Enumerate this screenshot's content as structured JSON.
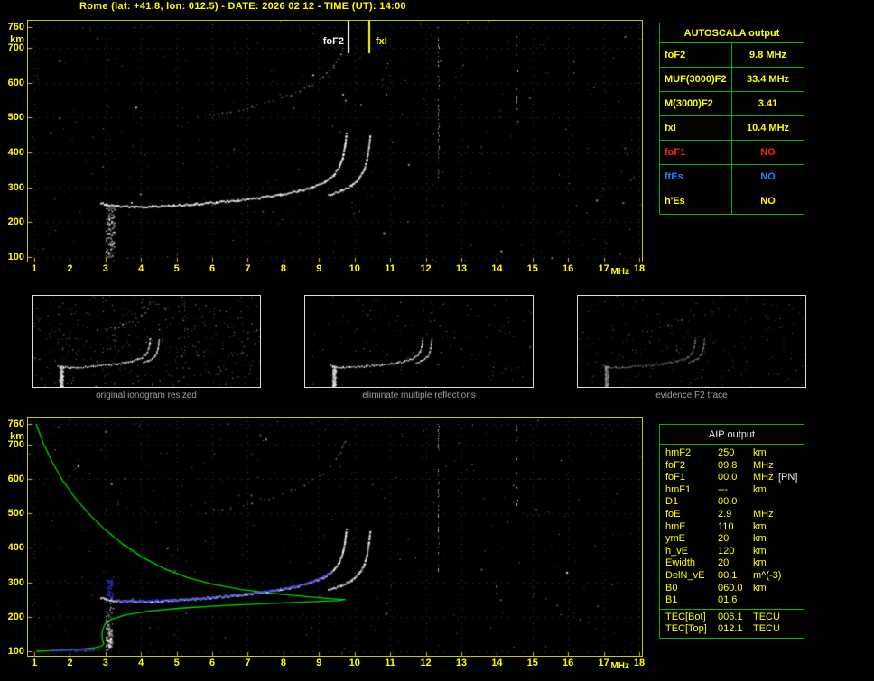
{
  "title": "Rome (lat: +41.8, lon: 012.5) - DATE: 2026 02 12 - TIME (UT): 14:00",
  "colors": {
    "accent_yellow": "#ffff00",
    "plot_border": "#c8c800",
    "table_green": "#00b400",
    "profile_green": "#00d800",
    "trace_white": "#ffffff",
    "overlay_blue": "#3434ff",
    "caption_gray": "#9f9f9f"
  },
  "autoscala": {
    "title": "AUTOSCALA output",
    "rows": [
      {
        "label": "foF2",
        "value": "9.8 MHz",
        "color": "#ffff00"
      },
      {
        "label": "MUF(3000)F2",
        "value": "33.4 MHz",
        "color": "#ffff00"
      },
      {
        "label": "M(3000)F2",
        "value": "3.41",
        "color": "#ffff00"
      },
      {
        "label": "fxI",
        "value": "10.4 MHz",
        "color": "#ffff00"
      },
      {
        "label": "foF1",
        "value": "NO",
        "color": "#ff2020"
      },
      {
        "label": "ftEs",
        "value": "NO",
        "color": "#2a7fff"
      },
      {
        "label": "h'Es",
        "value": "NO",
        "color": "#ffff00"
      }
    ]
  },
  "thumbnails": [
    {
      "caption": "original ionogram resized",
      "style": "noisy"
    },
    {
      "caption": "eliminate multiple reflections",
      "style": "clean"
    },
    {
      "caption": "evidence F2 trace",
      "style": "dim"
    }
  ],
  "aip": {
    "title": "AIP output",
    "rows": [
      {
        "label": "hmF2",
        "value": "250",
        "unit": "km"
      },
      {
        "label": "foF2",
        "value": "09.8",
        "unit": "MHz"
      },
      {
        "label": "foF1",
        "value": "00.0",
        "unit": "MHz",
        "note": "[PN]"
      },
      {
        "label": "hmF1",
        "value": "---",
        "unit": "km"
      },
      {
        "label": "D1",
        "value": "00.0",
        "unit": ""
      },
      {
        "label": "foE",
        "value": "2.9",
        "unit": "MHz"
      },
      {
        "label": "hmE",
        "value": "110",
        "unit": "km"
      },
      {
        "label": "ymE",
        "value": "20",
        "unit": "km"
      },
      {
        "label": "h_vE",
        "value": "120",
        "unit": "km"
      },
      {
        "label": "Ewidth",
        "value": "20",
        "unit": "km"
      },
      {
        "label": "DelN_vE",
        "value": "00.1",
        "unit": "m^(-3)"
      },
      {
        "label": "B0",
        "value": "060.0",
        "unit": "km"
      },
      {
        "label": "B1",
        "value": "01.6",
        "unit": ""
      }
    ],
    "tec_rows": [
      {
        "label": "TEC[Bot]",
        "value": "006.1",
        "unit": "TECU"
      },
      {
        "label": "TEC[Top]",
        "value": "012.1",
        "unit": "TECU"
      }
    ]
  },
  "chart_data": [
    {
      "type": "scatter",
      "id": "ionogram_top",
      "title": "measured ionogram",
      "xlabel": "MHz",
      "ylabel": "km",
      "xlim": [
        1,
        18
      ],
      "ylim": [
        100,
        760
      ],
      "x_ticks": [
        1,
        2,
        3,
        4,
        5,
        6,
        7,
        8,
        9,
        10,
        11,
        12,
        13,
        14,
        15,
        16,
        17,
        18
      ],
      "y_ticks": [
        760,
        700,
        600,
        500,
        400,
        300,
        200,
        100
      ],
      "markers": [
        {
          "label": "foF2",
          "mhz": 9.8,
          "color": "#ffffff"
        },
        {
          "label": "fxI",
          "mhz": 10.4,
          "color": "#ffff00"
        }
      ],
      "series": [
        {
          "name": "F-trace-O",
          "style": "trace",
          "color": "#ffffff",
          "points": [
            [
              2.85,
              258
            ],
            [
              3.0,
              252
            ],
            [
              3.3,
              248
            ],
            [
              3.8,
              246
            ],
            [
              4.3,
              247
            ],
            [
              4.9,
              250
            ],
            [
              5.5,
              254
            ],
            [
              6.1,
              259
            ],
            [
              6.7,
              265
            ],
            [
              7.3,
              272
            ],
            [
              7.9,
              281
            ],
            [
              8.4,
              291
            ],
            [
              8.8,
              303
            ],
            [
              9.15,
              318
            ],
            [
              9.4,
              337
            ],
            [
              9.55,
              360
            ],
            [
              9.65,
              388
            ],
            [
              9.71,
              420
            ],
            [
              9.75,
              455
            ]
          ]
        },
        {
          "name": "F-trace-X",
          "style": "trace",
          "color": "#f2f2f2",
          "points": [
            [
              9.25,
              280
            ],
            [
              9.6,
              292
            ],
            [
              9.9,
              307
            ],
            [
              10.1,
              327
            ],
            [
              10.25,
              352
            ],
            [
              10.33,
              382
            ],
            [
              10.38,
              415
            ],
            [
              10.42,
              450
            ]
          ]
        },
        {
          "name": "second-hop-trace",
          "style": "trace-dim",
          "color": "#c8c8c8",
          "points": [
            [
              5.8,
              505
            ],
            [
              6.5,
              518
            ],
            [
              7.1,
              533
            ],
            [
              7.7,
              550
            ],
            [
              8.2,
              568
            ],
            [
              8.7,
              592
            ],
            [
              9.1,
              618
            ],
            [
              9.4,
              648
            ],
            [
              9.6,
              680
            ],
            [
              9.72,
              712
            ]
          ]
        },
        {
          "name": "E-region-spread",
          "style": "cluster",
          "color": "#e0e0e0",
          "count": 120,
          "points": [
            [
              3.0,
              100
            ],
            [
              3.25,
              255
            ]
          ]
        }
      ],
      "noise": {
        "specks": 330,
        "columns": [
          {
            "mhz": 12.35,
            "km_range": [
              330,
              760
            ],
            "strength": 0.5
          },
          {
            "mhz": 14.55,
            "km_range": [
              480,
              760
            ],
            "strength": 0.2
          },
          {
            "mhz": 10.9,
            "km_range": [
              560,
              760
            ],
            "strength": 0.14
          },
          {
            "mhz": 16.15,
            "km_range": [
              600,
              760
            ],
            "strength": 0.12
          }
        ]
      }
    },
    {
      "type": "scatter",
      "id": "ionogram_bottom",
      "title": "ionogram with autoscaled trace and electron density profile",
      "xlabel": "MHz",
      "ylabel": "km",
      "xlim": [
        1,
        18
      ],
      "ylim": [
        100,
        760
      ],
      "x_ticks": [
        1,
        2,
        3,
        4,
        5,
        6,
        7,
        8,
        9,
        10,
        11,
        12,
        13,
        14,
        15,
        16,
        17,
        18
      ],
      "y_ticks": [
        760,
        700,
        600,
        500,
        400,
        300,
        200,
        100
      ],
      "markers": [],
      "series": [
        {
          "name": "profile",
          "style": "line",
          "color": "#00d800",
          "points": [
            [
              1.05,
              760
            ],
            [
              1.25,
              705
            ],
            [
              1.5,
              650
            ],
            [
              1.8,
              595
            ],
            [
              2.15,
              545
            ],
            [
              2.55,
              497
            ],
            [
              3.0,
              452
            ],
            [
              3.5,
              410
            ],
            [
              4.05,
              372
            ],
            [
              4.65,
              340
            ],
            [
              5.3,
              314
            ],
            [
              6.0,
              295
            ],
            [
              6.8,
              280
            ],
            [
              7.7,
              268
            ],
            [
              8.7,
              258
            ],
            [
              9.55,
              251
            ],
            [
              9.75,
              250
            ],
            [
              9.5,
              247
            ],
            [
              8.6,
              243
            ],
            [
              7.4,
              238
            ],
            [
              6.2,
              232
            ],
            [
              5.1,
              225
            ],
            [
              4.2,
              216
            ],
            [
              3.55,
              205
            ],
            [
              3.15,
              192
            ],
            [
              2.98,
              178
            ],
            [
              2.92,
              162
            ],
            [
              2.9,
              146
            ],
            [
              2.92,
              132
            ],
            [
              2.95,
              122
            ],
            [
              2.9,
              115
            ],
            [
              2.7,
              110
            ],
            [
              2.3,
              106
            ],
            [
              1.8,
              103
            ],
            [
              1.3,
              101
            ],
            [
              1.05,
              100
            ]
          ]
        },
        {
          "name": "F-trace-O",
          "style": "trace",
          "color": "#ffffff",
          "points": [
            [
              2.85,
              258
            ],
            [
              3.0,
              252
            ],
            [
              3.3,
              248
            ],
            [
              3.8,
              246
            ],
            [
              4.3,
              247
            ],
            [
              4.9,
              250
            ],
            [
              5.5,
              254
            ],
            [
              6.1,
              259
            ],
            [
              6.7,
              265
            ],
            [
              7.3,
              272
            ],
            [
              7.9,
              281
            ],
            [
              8.4,
              291
            ],
            [
              8.8,
              303
            ],
            [
              9.15,
              318
            ],
            [
              9.4,
              337
            ],
            [
              9.55,
              360
            ],
            [
              9.65,
              388
            ],
            [
              9.71,
              420
            ],
            [
              9.75,
              455
            ]
          ]
        },
        {
          "name": "F-trace-X",
          "style": "trace",
          "color": "#f2f2f2",
          "points": [
            [
              9.25,
              280
            ],
            [
              9.6,
              292
            ],
            [
              9.9,
              307
            ],
            [
              10.1,
              327
            ],
            [
              10.25,
              352
            ],
            [
              10.33,
              382
            ],
            [
              10.38,
              415
            ],
            [
              10.42,
              450
            ]
          ]
        },
        {
          "name": "second-hop-trace",
          "style": "trace-dim",
          "color": "#b4b4b4",
          "points": [
            [
              5.8,
              505
            ],
            [
              6.5,
              518
            ],
            [
              7.1,
              533
            ],
            [
              7.7,
              550
            ],
            [
              8.2,
              568
            ],
            [
              8.7,
              592
            ],
            [
              9.1,
              618
            ],
            [
              9.4,
              648
            ],
            [
              9.6,
              680
            ],
            [
              9.72,
              712
            ]
          ]
        },
        {
          "name": "E-region-spread",
          "style": "cluster",
          "color": "#cfcfcf",
          "count": 60,
          "points": [
            [
              3.0,
              100
            ],
            [
              3.2,
              255
            ]
          ]
        },
        {
          "name": "E-trace",
          "style": "trace-dim",
          "color": "#d0d0d0",
          "points": [
            [
              1.5,
              104
            ],
            [
              2.8,
              104
            ]
          ]
        },
        {
          "name": "E-echo-vertical",
          "style": "cluster",
          "color": "#ffffff",
          "count": 60,
          "points": [
            [
              3.0,
              112
            ],
            [
              3.18,
              170
            ]
          ]
        },
        {
          "name": "autoscaled-F-trace",
          "style": "trace",
          "color": "#3434ff",
          "points": [
            [
              3.3,
              249
            ],
            [
              4.0,
              248
            ],
            [
              4.9,
              251
            ],
            [
              5.8,
              256
            ],
            [
              6.7,
              266
            ],
            [
              7.6,
              277
            ],
            [
              8.3,
              290
            ],
            [
              8.8,
              304
            ],
            [
              9.1,
              317
            ],
            [
              9.3,
              332
            ]
          ]
        },
        {
          "name": "autoscaled-F-start",
          "style": "cluster",
          "color": "#3434ff",
          "count": 45,
          "points": [
            [
              3.05,
              250
            ],
            [
              3.2,
              312
            ]
          ]
        },
        {
          "name": "autoscaled-E-trace",
          "style": "trace",
          "color": "#3434ff",
          "points": [
            [
              1.45,
              106
            ],
            [
              2.65,
              106
            ]
          ]
        }
      ],
      "noise": {
        "specks": 300,
        "columns": [
          {
            "mhz": 12.35,
            "km_range": [
              310,
              760
            ],
            "strength": 0.45
          },
          {
            "mhz": 14.55,
            "km_range": [
              500,
              760
            ],
            "strength": 0.18
          },
          {
            "mhz": 15.8,
            "km_range": [
              560,
              760
            ],
            "strength": 0.12
          }
        ]
      }
    }
  ]
}
